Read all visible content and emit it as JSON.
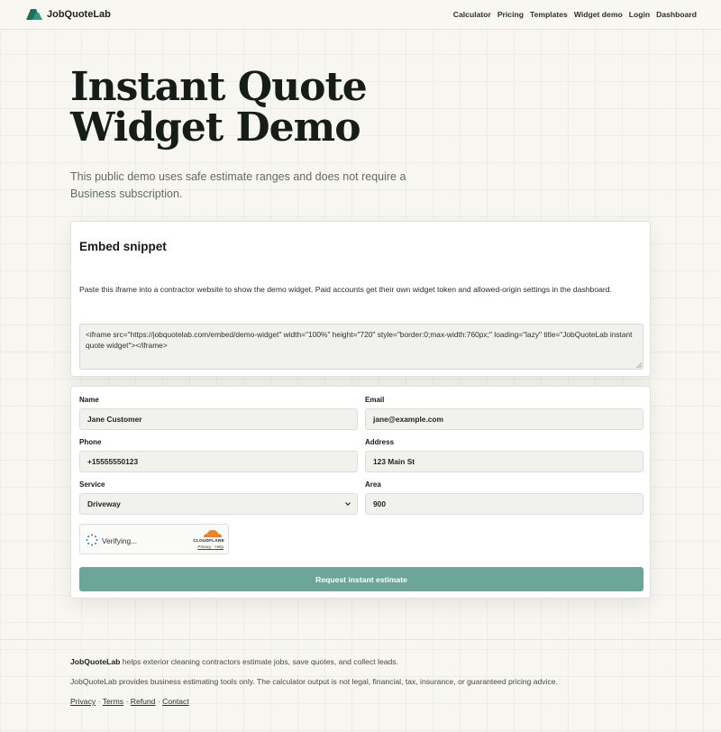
{
  "brand": {
    "name": "JobQuoteLab",
    "logo_icon": "mountain-logo-icon",
    "accent": "#1f6f5e"
  },
  "nav": [
    "Calculator",
    "Pricing",
    "Templates",
    "Widget demo",
    "Login",
    "Dashboard"
  ],
  "hero": {
    "title": "Instant Quote Widget Demo",
    "subtitle": "This public demo uses safe estimate ranges and does not require a Business subscription."
  },
  "embed": {
    "heading": "Embed snippet",
    "description": "Paste this iframe into a contractor website to show the demo widget. Paid accounts get their own widget token and allowed-origin settings in the dashboard.",
    "snippet": "<iframe src=\"https://jobquotelab.com/embed/demo-widget\" width=\"100%\" height=\"720\" style=\"border:0;max-width:760px;\" loading=\"lazy\" title=\"JobQuoteLab instant quote widget\"></iframe>"
  },
  "form": {
    "name_label": "Name",
    "name_value": "Jane Customer",
    "email_label": "Email",
    "email_value": "jane@example.com",
    "phone_label": "Phone",
    "phone_value": "+15555550123",
    "address_label": "Address",
    "address_value": "123 Main St",
    "service_label": "Service",
    "service_value": "Driveway",
    "area_label": "Area",
    "area_value": "900",
    "captcha": {
      "status": "Verifying...",
      "provider": "CLOUDFLARE",
      "privacy": "Privacy",
      "help": "Help",
      "separator": "·"
    },
    "submit_label": "Request instant estimate",
    "submit_color": "#6ea59b"
  },
  "footer": {
    "brand": "JobQuoteLab",
    "tagline": " helps exterior cleaning contractors estimate jobs, save quotes, and collect leads.",
    "disclaimer": "JobQuoteLab provides business estimating tools only. The calculator output is not legal, financial, tax, insurance, or guaranteed pricing advice.",
    "links": [
      "Privacy",
      "Terms",
      "Refund",
      "Contact"
    ],
    "separator": "·"
  }
}
